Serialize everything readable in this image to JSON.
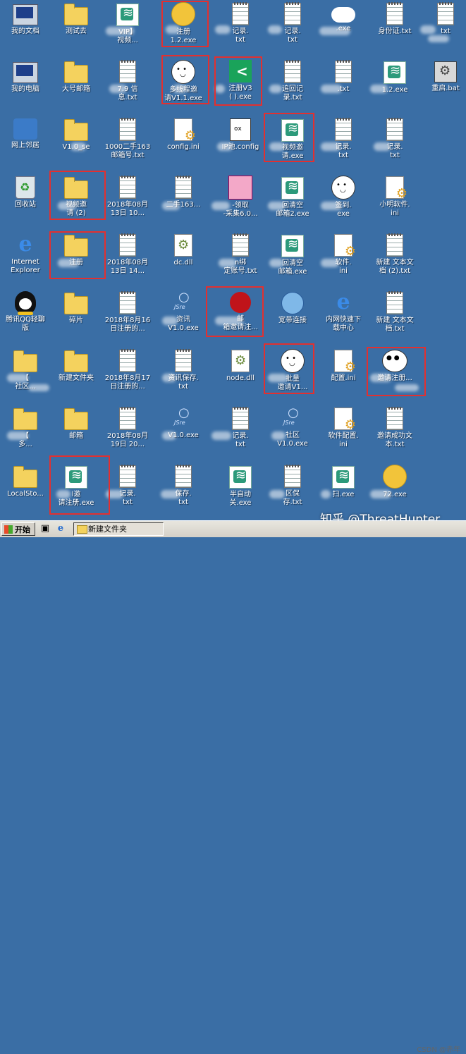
{
  "desktop": {
    "icons": [
      {
        "kind": "sys-docs",
        "label": "我的文档"
      },
      {
        "kind": "folder",
        "label": "测试去"
      },
      {
        "kind": "exe",
        "label": "VIP】\n视频..."
      },
      {
        "kind": "pic",
        "label": "注册\n1.2.exe"
      },
      {
        "kind": "txt",
        "label": "记录.\ntxt"
      },
      {
        "kind": "txt",
        "label": "记录.\ntxt"
      },
      {
        "kind": "cloud",
        "label": ".exe"
      },
      {
        "kind": "txt",
        "label": "身份证.txt"
      },
      {
        "kind": "txt",
        "label": "txt"
      },
      {
        "kind": "sys",
        "label": "我的电脑"
      },
      {
        "kind": "folder",
        "label": "大号邮箱"
      },
      {
        "kind": "txt",
        "label": "7.9 信\n息.txt"
      },
      {
        "kind": "face",
        "label": "多线程邀\n请V1.1.exe"
      },
      {
        "kind": "share",
        "label": "注册V3\n( ).exe"
      },
      {
        "kind": "txt",
        "label": "追回记\n录.txt"
      },
      {
        "kind": "txt",
        "label": ".txt"
      },
      {
        "kind": "exe",
        "label": "1.2.exe"
      },
      {
        "kind": "bat",
        "label": "重启.bat"
      },
      {
        "kind": "net",
        "label": "网上邻居"
      },
      {
        "kind": "folder",
        "label": "V1.0_se"
      },
      {
        "kind": "txt",
        "label": "1000二手163\n邮箱号.txt"
      },
      {
        "kind": "ini",
        "label": "config.ini"
      },
      {
        "kind": "config",
        "label": "IP池.config"
      },
      {
        "kind": "exe",
        "label": "视频邀\n请.exe"
      },
      {
        "kind": "txt",
        "label": "记录.\ntxt"
      },
      {
        "kind": "txt",
        "label": "记录.\ntxt"
      },
      {
        "kind": "none",
        "label": ""
      },
      {
        "kind": "bin",
        "label": "回收站"
      },
      {
        "kind": "folder",
        "label": "视频邀\n请 (2)"
      },
      {
        "kind": "txt",
        "label": "2018年08月\n13日 10..."
      },
      {
        "kind": "txt",
        "label": "二手163..."
      },
      {
        "kind": "anime",
        "label": "-领取\n-采集6.0..."
      },
      {
        "kind": "exe",
        "label": "回清空\n邮箱2.exe"
      },
      {
        "kind": "face",
        "label": "签到.\nexe"
      },
      {
        "kind": "ini",
        "label": "小明软件.\nini"
      },
      {
        "kind": "none",
        "label": ""
      },
      {
        "kind": "ie",
        "label": "Internet\nExplorer"
      },
      {
        "kind": "folder",
        "label": "注册"
      },
      {
        "kind": "txt",
        "label": "2018年08月\n13日 14..."
      },
      {
        "kind": "dll",
        "label": "dc.dll"
      },
      {
        "kind": "txt",
        "label": "n绑\n定账号.txt"
      },
      {
        "kind": "exe",
        "label": "回清空\n邮箱.exe"
      },
      {
        "kind": "ini",
        "label": "软件.\nini"
      },
      {
        "kind": "txt",
        "label": "新建 文本文\n档 (2).txt"
      },
      {
        "kind": "none",
        "label": ""
      },
      {
        "kind": "qq",
        "label": "腾讯QQ轻聊\n版"
      },
      {
        "kind": "folder",
        "label": "碎片"
      },
      {
        "kind": "txt",
        "label": "2018年8月16\n日注册的..."
      },
      {
        "kind": "jsre",
        "label": "资讯\nV1.0.exe"
      },
      {
        "kind": "red",
        "label": "邮\n箱邀请注..."
      },
      {
        "kind": "globe",
        "label": "宽带连接"
      },
      {
        "kind": "ie",
        "label": "内网快速下\n载中心"
      },
      {
        "kind": "txt",
        "label": "新建 文本文\n档.txt"
      },
      {
        "kind": "none",
        "label": ""
      },
      {
        "kind": "folder",
        "label": "【 \n社区..."
      },
      {
        "kind": "folder",
        "label": "新建文件夹"
      },
      {
        "kind": "txt",
        "label": "2018年8月17\n日注册的..."
      },
      {
        "kind": "txt",
        "label": "资讯保存.\ntxt"
      },
      {
        "kind": "dll",
        "label": "node.dll"
      },
      {
        "kind": "face",
        "label": "批量\n邀请V1..."
      },
      {
        "kind": "ini",
        "label": "配置.ini"
      },
      {
        "kind": "panda",
        "label": "邀请注册..."
      },
      {
        "kind": "none",
        "label": ""
      },
      {
        "kind": "folder",
        "label": "【 \n 多..."
      },
      {
        "kind": "folder",
        "label": "邮箱"
      },
      {
        "kind": "txt",
        "label": "2018年08月\n19日 20..."
      },
      {
        "kind": "jsre",
        "label": "V1.0.exe"
      },
      {
        "kind": "txt",
        "label": "记录.\ntxt"
      },
      {
        "kind": "jsre",
        "label": "社区\nV1.0.exe"
      },
      {
        "kind": "ini",
        "label": "软件配置.\nini"
      },
      {
        "kind": "txt",
        "label": "邀请成功文\n本.txt"
      },
      {
        "kind": "none",
        "label": ""
      },
      {
        "kind": "folder",
        "label": "LocalSto..."
      },
      {
        "kind": "exe",
        "label": "l邀\n请注册.exe"
      },
      {
        "kind": "txt",
        "label": "记录.\ntxt"
      },
      {
        "kind": "txt",
        "label": "保存.\ntxt"
      },
      {
        "kind": "exe",
        "label": "半自动\n关.exe"
      },
      {
        "kind": "txt",
        "label": "区保\n存.txt"
      },
      {
        "kind": "exe",
        "label": "扫.exe"
      },
      {
        "kind": "pic",
        "label": "72.exe"
      },
      {
        "kind": "none",
        "label": ""
      }
    ]
  },
  "taskbar": {
    "start_label": "开始",
    "window_title": "新建文件夹"
  },
  "watermark": "知乎 @ThreatHunter",
  "credit": "CSDN @赤年",
  "colors": {
    "desktop": "#3a6ea5",
    "highlight_box": "#e23030"
  }
}
